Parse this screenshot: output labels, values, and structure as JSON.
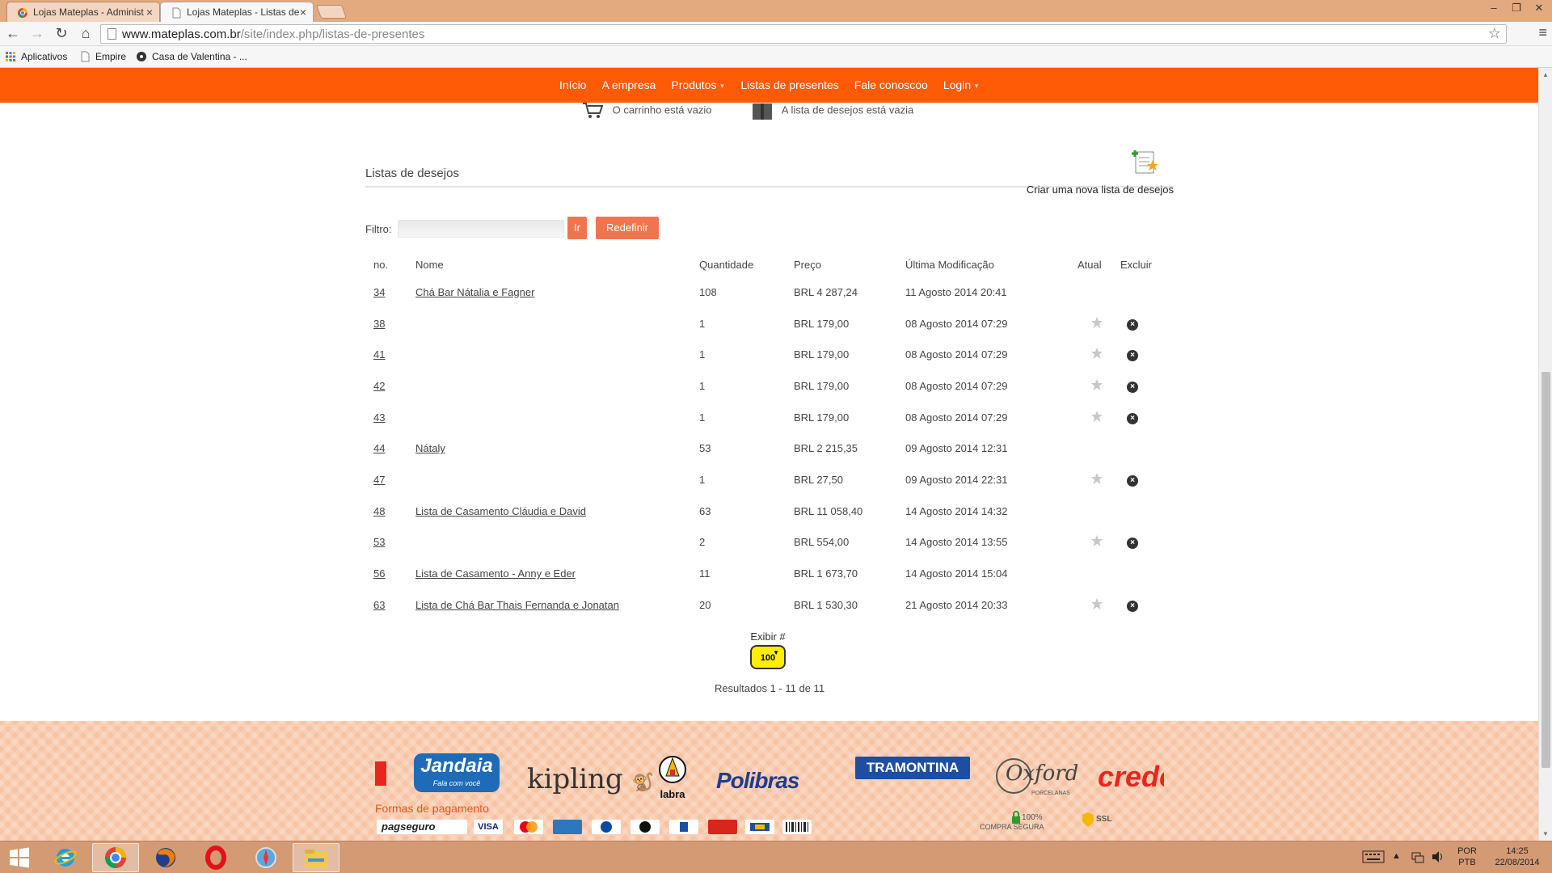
{
  "browser": {
    "tabs": [
      {
        "title": "Lojas Mateplas - Administ",
        "active": false
      },
      {
        "title": "Lojas Mateplas - Listas de",
        "active": true
      }
    ],
    "url": {
      "domain": "www.mateplas.com.br",
      "path": "/site/index.php/listas-de-presentes"
    },
    "bookmarks": [
      "Aplicativos",
      "Empire",
      "Casa de Valentina - ..."
    ]
  },
  "nav": {
    "items": [
      "Início",
      "A empresa",
      "Produtos",
      "Listas de presentes",
      "Fale conoscoo",
      "Login"
    ]
  },
  "cart": {
    "cart_text": "O carrinho está vazio",
    "wishlist_text": "A lista de desejos está vazia"
  },
  "lists": {
    "title": "Listas de desejos",
    "new_list_label": "Criar uma nova lista de desejos",
    "filter_label": "Filtro:",
    "go_label": "Ir",
    "reset_label": "Redefinir",
    "columns": [
      "no.",
      "Nome",
      "Quantidade",
      "Preço",
      "Última Modificação",
      "Atual",
      "Excluir"
    ],
    "rows": [
      {
        "no": "34",
        "name": "Chá Bar Nátalia e Fagner",
        "qty": "108",
        "price": "BRL 4 287,24",
        "modified": "11 Agosto 2014 20:41",
        "actions": false
      },
      {
        "no": "38",
        "name": "",
        "qty": "1",
        "price": "BRL 179,00",
        "modified": "08 Agosto 2014 07:29",
        "actions": true
      },
      {
        "no": "41",
        "name": "",
        "qty": "1",
        "price": "BRL 179,00",
        "modified": "08 Agosto 2014 07:29",
        "actions": true
      },
      {
        "no": "42",
        "name": "",
        "qty": "1",
        "price": "BRL 179,00",
        "modified": "08 Agosto 2014 07:29",
        "actions": true
      },
      {
        "no": "43",
        "name": "",
        "qty": "1",
        "price": "BRL 179,00",
        "modified": "08 Agosto 2014 07:29",
        "actions": true
      },
      {
        "no": "44",
        "name": "Nátaly",
        "qty": "53",
        "price": "BRL 2 215,35",
        "modified": "09 Agosto 2014 12:31",
        "actions": false
      },
      {
        "no": "47",
        "name": "",
        "qty": "1",
        "price": "BRL 27,50",
        "modified": "09 Agosto 2014 22:31",
        "actions": true
      },
      {
        "no": "48",
        "name": "Lista de Casamento Cláudia e David",
        "qty": "63",
        "price": "BRL 11 058,40",
        "modified": "14 Agosto 2014 14:32",
        "actions": false
      },
      {
        "no": "53",
        "name": "",
        "qty": "2",
        "price": "BRL 554,00",
        "modified": "14 Agosto 2014 13:55",
        "actions": true
      },
      {
        "no": "56",
        "name": "Lista de Casamento - Anny e Eder",
        "qty": "11",
        "price": "BRL 1 673,70",
        "modified": "14 Agosto 2014 15:04",
        "actions": false
      },
      {
        "no": "63",
        "name": "Lista de Chá Bar Thais Fernanda e Jonatan",
        "qty": "20",
        "price": "BRL 1 530,30",
        "modified": "21 Agosto 2014 20:33",
        "actions": true
      }
    ],
    "display_label": "Exibir #",
    "display_value": "100",
    "results_text": "Resultados 1 - 11 de 11"
  },
  "footer": {
    "brands": [
      "Jandaia",
      "Fala com você",
      "kipling",
      "labra",
      "Polibras",
      "TRAMONTINA",
      "Oxford",
      "PORCELANAS",
      "credeal"
    ],
    "payments_title": "Formas de pagamento",
    "payment_methods": [
      "pagseguro",
      "VISA"
    ],
    "security": [
      "100%",
      "COMPRA SEGURA",
      "SSL"
    ]
  },
  "taskbar": {
    "lang": "POR",
    "layout": "PTB",
    "time": "14:25",
    "date": "22/08/2014"
  },
  "colors": {
    "nav_orange": "#ff5a05",
    "button_orange": "#f0754f",
    "footer_peach": "#f7c3a3",
    "taskbar": "#d39a74"
  }
}
